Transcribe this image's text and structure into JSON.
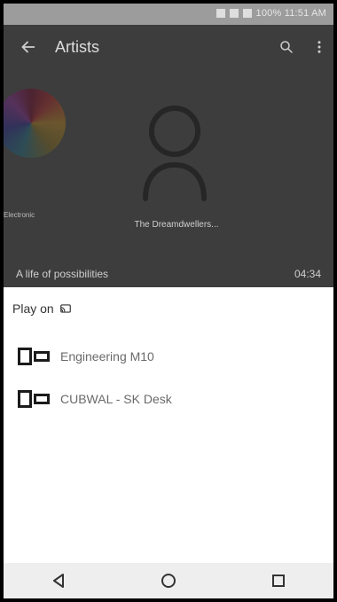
{
  "status_bar": {
    "text": "100% 11:51 AM"
  },
  "app": {
    "title": "Artists",
    "back_icon": "back-arrow-icon",
    "search_icon": "search-icon",
    "more_icon": "more-vert-icon",
    "artists": [
      {
        "name": "Electronic",
        "art": "colorful-disk"
      },
      {
        "name": "The Dreamdwellers...",
        "art": "person-placeholder-icon"
      }
    ],
    "now_playing": {
      "title": "A life of possibilities",
      "time": "04:34"
    }
  },
  "sheet": {
    "title": "Play on",
    "cast_icon": "cast-icon",
    "devices": [
      {
        "label": "Engineering M10",
        "icon": "dlna-device-icon"
      },
      {
        "label": "CUBWAL - SK Desk",
        "icon": "dlna-device-icon"
      }
    ]
  },
  "navigation": {
    "back_icon": "nav-back-triangle-icon",
    "home_icon": "nav-home-circle-icon",
    "recents_icon": "nav-recents-square-icon"
  },
  "colors": {
    "overlay": "#3d3d3d",
    "sheet_bg": "#ffffff",
    "nav_bg": "#eeeeee",
    "text_dark": "#333333",
    "text_muted": "#6a6a6a"
  }
}
